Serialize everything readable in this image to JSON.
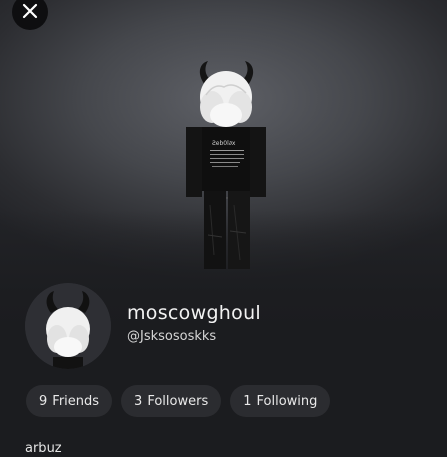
{
  "header": {
    "close_icon": "close-icon"
  },
  "profile": {
    "display_name": "moscowghoul",
    "username": "@Jsksososkks",
    "stats": [
      {
        "count": "9",
        "label": "Friends"
      },
      {
        "count": "3",
        "label": "Followers"
      },
      {
        "count": "1",
        "label": "Following"
      }
    ],
    "about": "arbuz"
  },
  "colors": {
    "background": "#1b1c1f",
    "pill": "#2b2c30",
    "text": "#f2f2f2"
  }
}
